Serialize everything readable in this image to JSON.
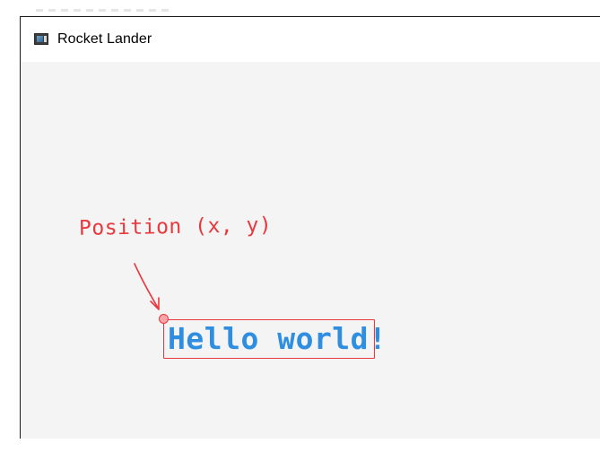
{
  "window": {
    "title": "Rocket Lander",
    "icon": "app-window-icon"
  },
  "annotation": {
    "label": "Position (x, y)",
    "color": "#e8383d"
  },
  "content": {
    "text": "Hello world!",
    "text_color": "#2f8ee0"
  }
}
